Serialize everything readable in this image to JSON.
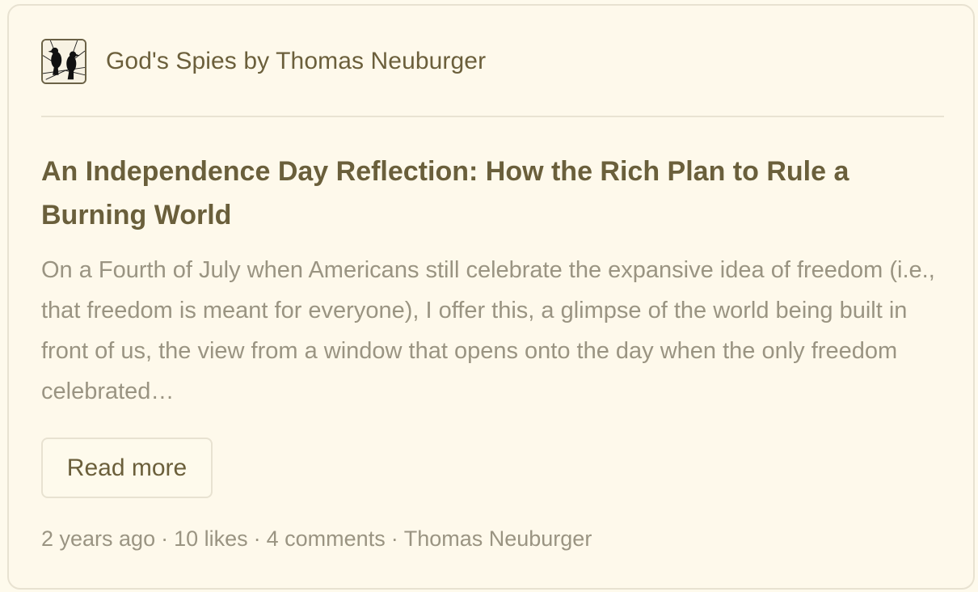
{
  "publication": {
    "name": "God's Spies by Thomas Neuburger",
    "logo_icon": "two-crows-on-branch-icon"
  },
  "post": {
    "title": "An Independence Day Reflection: How the Rich Plan to Rule a Burning World",
    "excerpt": "On a Fourth of July when Americans still celebrate the expansive idea of freedom (i.e., that freedom is meant for everyone), I offer this, a glimpse of the world being built in front of us, the view from a window that opens onto the day when the only freedom celebrated…",
    "read_more_label": "Read more"
  },
  "meta": {
    "age": "2 years ago",
    "separator": "·",
    "likes": "10 likes",
    "comments": "4 comments",
    "author": "Thomas Neuburger"
  },
  "colors": {
    "background": "#fefaec",
    "title": "#6a5f3b",
    "muted": "#9a9482",
    "border": "#e8e2d1"
  }
}
